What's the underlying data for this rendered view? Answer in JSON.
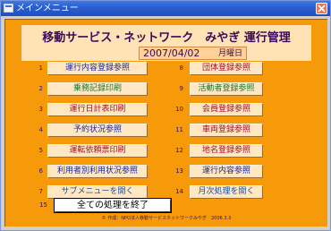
{
  "window": {
    "title": "メインメニュー"
  },
  "header": {
    "title": "移動サービス・ネットワーク　みやぎ 運行管理",
    "date": "2007/04/02",
    "weekday": "月曜日"
  },
  "menu": {
    "left": [
      {
        "num": "1",
        "label": "運行内容登録参照"
      },
      {
        "num": "2",
        "label": "乗務記録印刷"
      },
      {
        "num": "3",
        "label": "運行日計表印刷"
      },
      {
        "num": "4",
        "label": "予約状況参照"
      },
      {
        "num": "5",
        "label": "運転依頼票印刷"
      },
      {
        "num": "6",
        "label": "利用者別利用状況参照"
      },
      {
        "num": "7",
        "label": "サブメニューを開く"
      }
    ],
    "right": [
      {
        "num": "8",
        "label": "団体登録参照"
      },
      {
        "num": "9",
        "label": "活動者登録参照"
      },
      {
        "num": "10",
        "label": "会員登録参照"
      },
      {
        "num": "11",
        "label": "車両登録参照"
      },
      {
        "num": "12",
        "label": "地名登録参照"
      },
      {
        "num": "13",
        "label": "運行内容参照"
      },
      {
        "num": "14",
        "label": "月次処理を開く"
      }
    ],
    "exit": {
      "num": "15",
      "label": "全ての処理を終了"
    }
  },
  "footer": {
    "text": "© 作成：NPO法人移動サービスネットワークみやぎ　2006.3.3"
  },
  "colors": {
    "form_bg": "#f79a09",
    "header_bg": "#ffe2b6",
    "button_bg": "#ffe7c2",
    "titlebar": "#2a5fd0"
  }
}
